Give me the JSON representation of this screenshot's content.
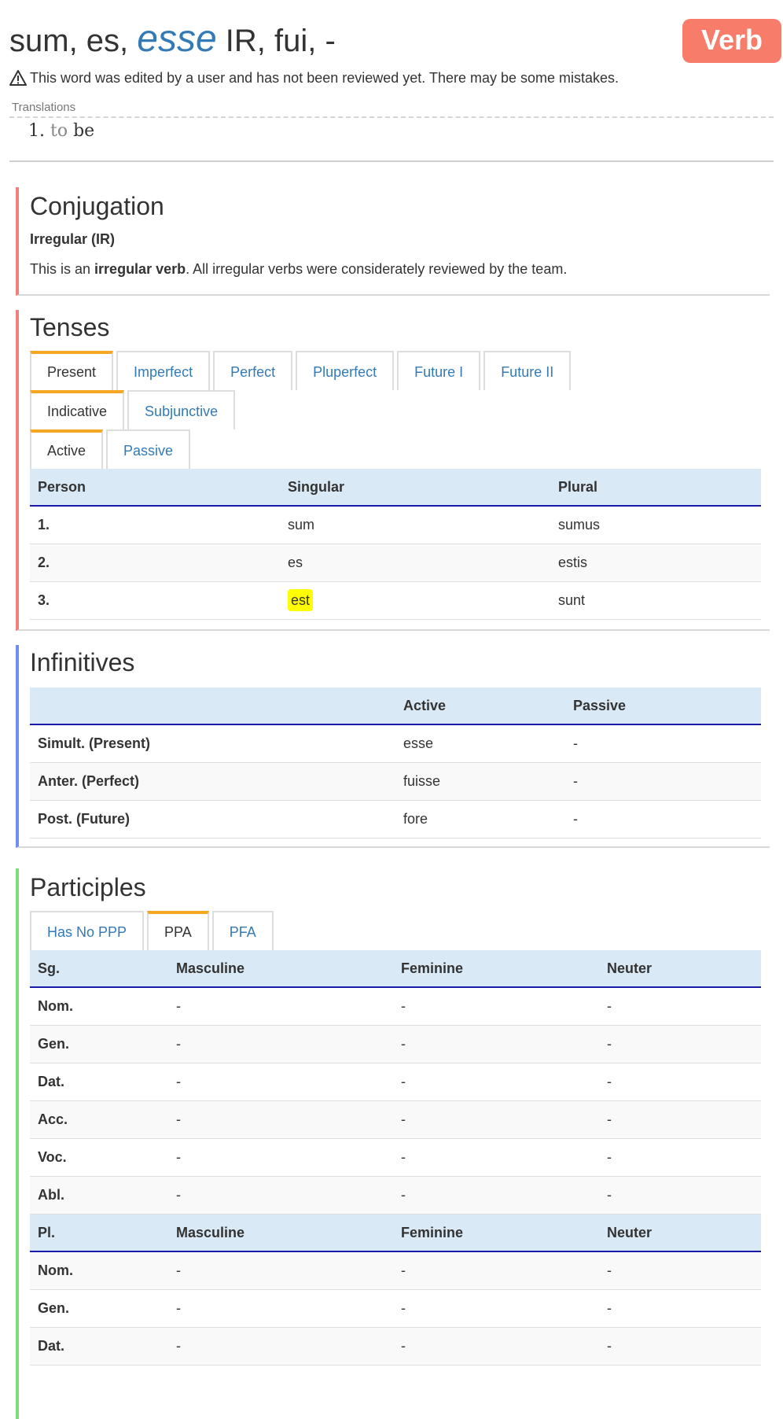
{
  "header": {
    "title_pre": "sum, es,",
    "title_inf": "esse",
    "title_post": "IR, fui, -",
    "badge": "Verb",
    "warning": "This word was edited by a user and has not been reviewed yet. There may be some mistakes.",
    "warning_icon": "warning-triangle-icon"
  },
  "translations": {
    "label": "Translations",
    "items": [
      {
        "num": "1.",
        "prefix": "to",
        "word": "be"
      }
    ]
  },
  "conjugation": {
    "heading": "Conjugation",
    "type": "Irregular (IR)",
    "desc_pre": "This is an",
    "desc_bold": "irregular verb",
    "desc_post": ". All irregular verbs were considerately reviewed by the team."
  },
  "tenses": {
    "heading": "Tenses",
    "tense_tabs": [
      "Present",
      "Imperfect",
      "Perfect",
      "Pluperfect",
      "Future I",
      "Future II"
    ],
    "mood_tabs": [
      "Indicative",
      "Subjunctive"
    ],
    "voice_tabs": [
      "Active",
      "Passive"
    ],
    "columns": [
      "Person",
      "Singular",
      "Plural"
    ],
    "rows": [
      {
        "person": "1.",
        "singular": "sum",
        "plural": "sumus"
      },
      {
        "person": "2.",
        "singular": "es",
        "plural": "estis"
      },
      {
        "person": "3.",
        "singular": "est",
        "plural": "sunt"
      }
    ]
  },
  "infinitives": {
    "heading": "Infinitives",
    "columns": [
      "",
      "Active",
      "Passive"
    ],
    "rows": [
      {
        "label": "Simult. (Present)",
        "active": "esse",
        "passive": "-"
      },
      {
        "label": "Anter. (Perfect)",
        "active": "fuisse",
        "passive": "-"
      },
      {
        "label": "Post. (Future)",
        "active": "fore",
        "passive": "-"
      }
    ]
  },
  "participles": {
    "heading": "Participles",
    "tabs": [
      "Has No PPP",
      "PPA",
      "PFA"
    ],
    "sg_columns": [
      "Sg.",
      "Masculine",
      "Feminine",
      "Neuter"
    ],
    "sg_rows": [
      {
        "case": "Nom.",
        "m": "-",
        "f": "-",
        "n": "-"
      },
      {
        "case": "Gen.",
        "m": "-",
        "f": "-",
        "n": "-"
      },
      {
        "case": "Dat.",
        "m": "-",
        "f": "-",
        "n": "-"
      },
      {
        "case": "Acc.",
        "m": "-",
        "f": "-",
        "n": "-"
      },
      {
        "case": "Voc.",
        "m": "-",
        "f": "-",
        "n": "-"
      },
      {
        "case": "Abl.",
        "m": "-",
        "f": "-",
        "n": "-"
      }
    ],
    "pl_columns": [
      "Pl.",
      "Masculine",
      "Feminine",
      "Neuter"
    ],
    "pl_rows": [
      {
        "case": "Nom.",
        "m": "-",
        "f": "-",
        "n": "-"
      },
      {
        "case": "Gen.",
        "m": "-",
        "f": "-",
        "n": "-"
      },
      {
        "case": "Dat.",
        "m": "-",
        "f": "-",
        "n": "-"
      }
    ]
  }
}
